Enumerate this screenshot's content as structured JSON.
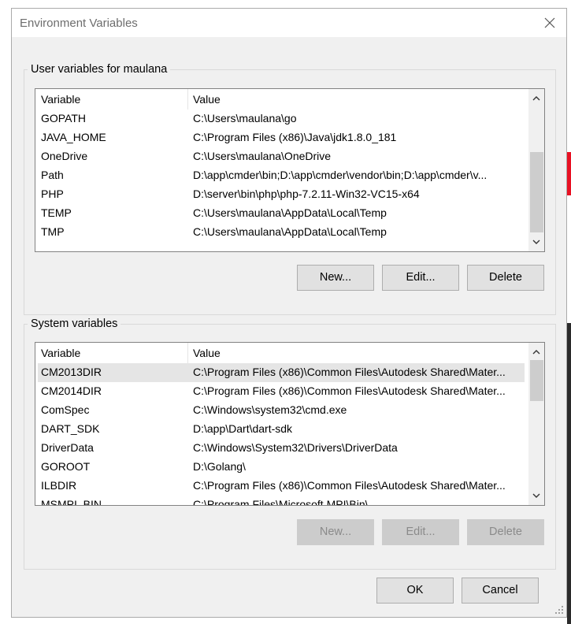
{
  "window": {
    "title": "Environment Variables"
  },
  "user_vars": {
    "legend": "User variables for maulana",
    "col_variable": "Variable",
    "col_value": "Value",
    "rows": [
      {
        "name": "GOPATH",
        "value": "C:\\Users\\maulana\\go"
      },
      {
        "name": "JAVA_HOME",
        "value": "C:\\Program Files (x86)\\Java\\jdk1.8.0_181"
      },
      {
        "name": "OneDrive",
        "value": "C:\\Users\\maulana\\OneDrive"
      },
      {
        "name": "Path",
        "value": "D:\\app\\cmder\\bin;D:\\app\\cmder\\vendor\\bin;D:\\app\\cmder\\v..."
      },
      {
        "name": "PHP",
        "value": "D:\\server\\bin\\php\\php-7.2.11-Win32-VC15-x64"
      },
      {
        "name": "TEMP",
        "value": "C:\\Users\\maulana\\AppData\\Local\\Temp"
      },
      {
        "name": "TMP",
        "value": "C:\\Users\\maulana\\AppData\\Local\\Temp"
      }
    ],
    "buttons": {
      "new": "New...",
      "edit": "Edit...",
      "delete": "Delete"
    }
  },
  "system_vars": {
    "legend": "System variables",
    "col_variable": "Variable",
    "col_value": "Value",
    "rows": [
      {
        "name": "CM2013DIR",
        "value": "C:\\Program Files (x86)\\Common Files\\Autodesk Shared\\Mater...",
        "selected": true
      },
      {
        "name": "CM2014DIR",
        "value": "C:\\Program Files (x86)\\Common Files\\Autodesk Shared\\Mater..."
      },
      {
        "name": "ComSpec",
        "value": "C:\\Windows\\system32\\cmd.exe"
      },
      {
        "name": "DART_SDK",
        "value": "D:\\app\\Dart\\dart-sdk"
      },
      {
        "name": "DriverData",
        "value": "C:\\Windows\\System32\\Drivers\\DriverData"
      },
      {
        "name": "GOROOT",
        "value": "D:\\Golang\\"
      },
      {
        "name": "ILBDIR",
        "value": "C:\\Program Files (x86)\\Common Files\\Autodesk Shared\\Mater..."
      },
      {
        "name": "MSMPI_BIN",
        "value": "C:\\Program Files\\Microsoft MPI\\Bin\\"
      }
    ],
    "buttons": {
      "new": "New...",
      "edit": "Edit...",
      "delete": "Delete"
    }
  },
  "footer": {
    "ok": "OK",
    "cancel": "Cancel"
  },
  "colors": {
    "selected_row": "#e5e5e5",
    "dialog_bg": "#f0f0f0",
    "button_bg": "#e1e1e1"
  }
}
